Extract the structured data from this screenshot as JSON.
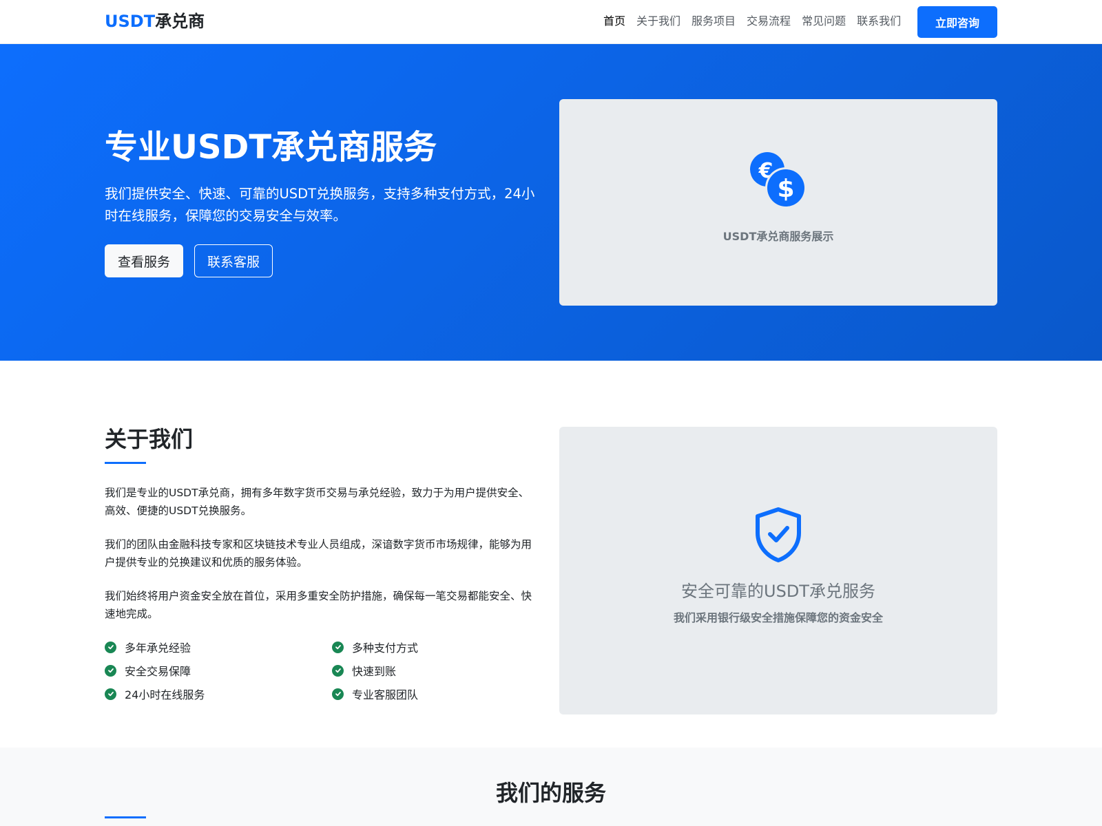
{
  "navbar": {
    "brand_prefix": "USDT",
    "brand_suffix": "承兑商",
    "links": [
      "首页",
      "关于我们",
      "服务项目",
      "交易流程",
      "常见问题",
      "联系我们"
    ],
    "cta_label": "立即咨询"
  },
  "hero": {
    "title": "专业USDT承兑商服务",
    "subtitle": "我们提供安全、快速、可靠的USDT兑换服务，支持多种支付方式，24小时在线服务，保障您的交易安全与效率。",
    "primary_button": "查看服务",
    "secondary_button": "联系客服",
    "card_caption": "USDT承兑商服务展示",
    "card_icon": "currency-exchange-icon"
  },
  "about": {
    "title": "关于我们",
    "paragraphs": [
      "我们是专业的USDT承兑商，拥有多年数字货币交易与承兑经验，致力于为用户提供安全、高效、便捷的USDT兑换服务。",
      "我们的团队由金融科技专家和区块链技术专业人员组成，深谙数字货币市场规律，能够为用户提供专业的兑换建议和优质的服务体验。",
      "我们始终将用户资金安全放在首位，采用多重安全防护措施，确保每一笔交易都能安全、快速地完成。"
    ],
    "features": [
      "多年承兑经验",
      "多种支付方式",
      "安全交易保障",
      "快速到账",
      "24小时在线服务",
      "专业客服团队"
    ],
    "card_icon": "shield-check-icon",
    "card_title": "安全可靠的USDT承兑服务",
    "card_subtitle": "我们采用银行级安全措施保障您的资金安全"
  },
  "services": {
    "title": "我们的服务"
  },
  "colors": {
    "primary": "#0d6efd",
    "primary_dark": "#0a58ca",
    "success": "#198754",
    "muted": "#6c757d",
    "card_bg": "#e9ecef",
    "section_bg": "#f8f9fa"
  }
}
